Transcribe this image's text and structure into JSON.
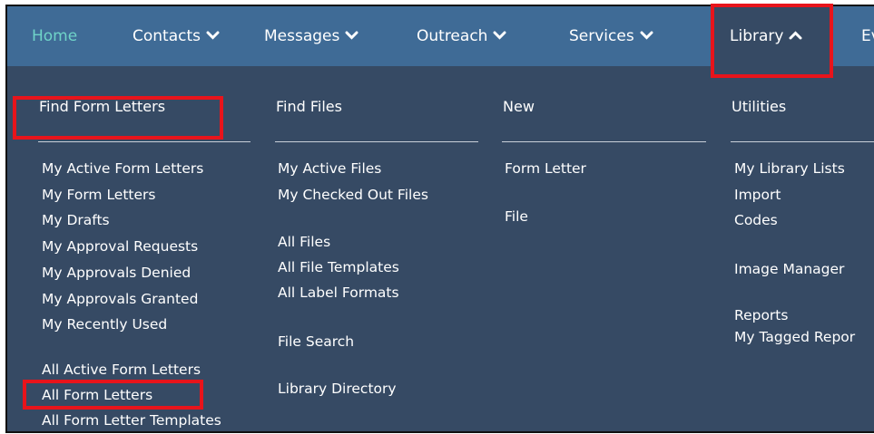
{
  "nav": {
    "items": [
      {
        "label": "Home"
      },
      {
        "label": "Contacts"
      },
      {
        "label": "Messages"
      },
      {
        "label": "Outreach"
      },
      {
        "label": "Services"
      },
      {
        "label": "Library"
      },
      {
        "label": "Ev"
      }
    ]
  },
  "menu": {
    "columns": [
      {
        "heading": "Find Form Letters",
        "links": [
          "My Active Form Letters",
          "My Form Letters",
          "My Drafts",
          "My Approval Requests",
          "My Approvals Denied",
          "My Approvals Granted",
          "My Recently Used",
          "All Active Form Letters",
          "All Form Letters",
          "All Form Letter Templates"
        ]
      },
      {
        "heading": "Find Files",
        "links": [
          "My Active Files",
          "My Checked Out Files",
          "All Files",
          "All File Templates",
          "All Label Formats",
          "File Search",
          "Library Directory"
        ]
      },
      {
        "heading": "New",
        "links": [
          "Form Letter",
          "File"
        ]
      },
      {
        "heading": "Utilities",
        "links": [
          "My Library Lists",
          "Import",
          "Codes",
          "Image Manager",
          "Reports",
          "My Tagged Repor"
        ]
      }
    ]
  },
  "colors": {
    "nav_bg": "#3f6b96",
    "menu_bg": "#364a64",
    "home_text": "#6fd3c8",
    "highlight": "#e8141b"
  }
}
